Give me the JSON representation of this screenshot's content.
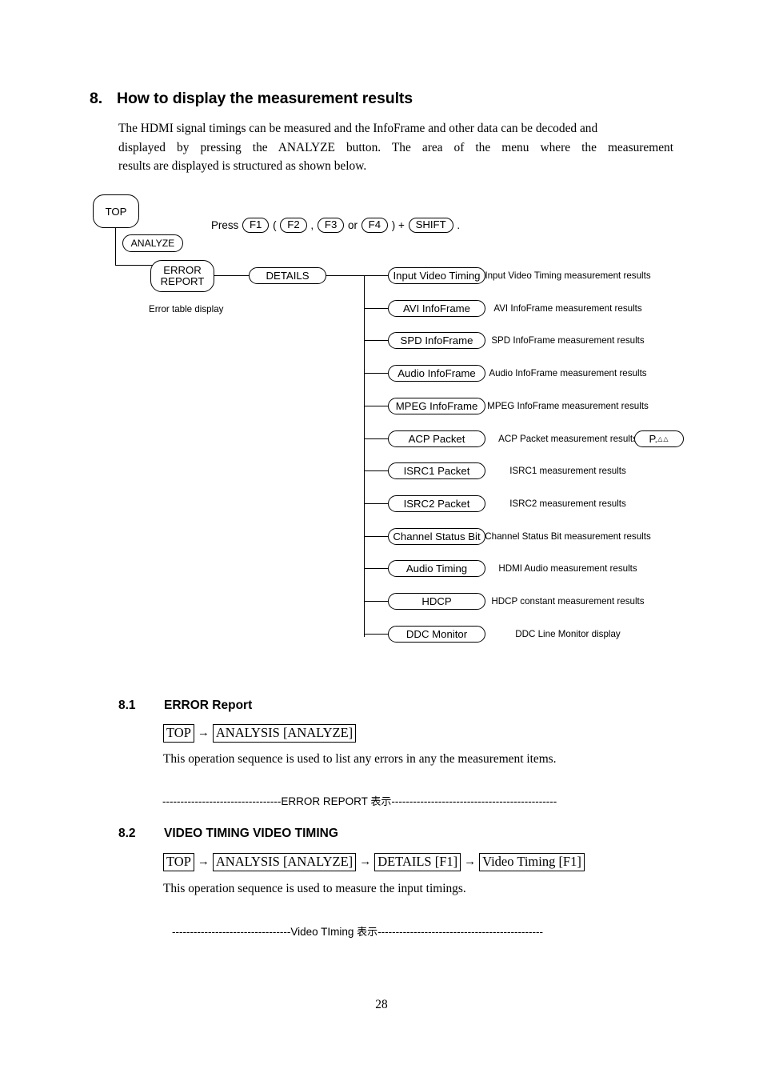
{
  "section": {
    "number": "8.",
    "title": "How to display the measurement results",
    "intro_lines": [
      "The HDMI signal timings can be measured and the InfoFrame and other data can be decoded and",
      "displayed by pressing the ANALYZE button.   The area of the menu where the measurement",
      "results are displayed is structured as shown below."
    ]
  },
  "diagram": {
    "top_node": "TOP",
    "analyze_node": "ANALYZE",
    "error_report_node": "ERROR\nREPORT",
    "error_report_line1": "ERROR",
    "error_report_line2": "REPORT",
    "error_note": "Error table display",
    "details_node": "DETAILS",
    "press_line": {
      "prefix": "Press",
      "key1": "F1",
      "open_paren": "(",
      "key2": "F2",
      "comma": ",",
      "key3": "F3",
      "or": "or",
      "key4": "F4",
      "close_paren": ")",
      "plus": "+",
      "key5": "SHIFT",
      "period": "."
    },
    "badge": {
      "label": "P.",
      "triangles": "△△"
    },
    "items": [
      {
        "label": "Input Video Timing",
        "desc": "Input Video Timing measurement results"
      },
      {
        "label": "AVI InfoFrame",
        "desc": "AVI InfoFrame measurement results"
      },
      {
        "label": "SPD InfoFrame",
        "desc": "SPD InfoFrame measurement results"
      },
      {
        "label": "Audio InfoFrame",
        "desc": "Audio InfoFrame measurement results"
      },
      {
        "label": "MPEG InfoFrame",
        "desc": "MPEG InfoFrame measurement results"
      },
      {
        "label": "ACP Packet",
        "desc": "ACP Packet measurement results"
      },
      {
        "label": "ISRC1 Packet",
        "desc": "ISRC1 measurement results"
      },
      {
        "label": "ISRC2 Packet",
        "desc": "ISRC2 measurement results"
      },
      {
        "label": "Channel Status Bit",
        "desc": "Channel Status Bit measurement results"
      },
      {
        "label": "Audio Timing",
        "desc": "HDMI Audio measurement results"
      },
      {
        "label": "HDCP",
        "desc": "HDCP constant measurement results"
      },
      {
        "label": "DDC Monitor",
        "desc": "DDC Line Monitor display"
      }
    ]
  },
  "sub1": {
    "number": "8.1",
    "title": "ERROR Report",
    "sequence": [
      "TOP",
      "ANALYSIS [ANALYZE]"
    ],
    "arrow": "→",
    "body": "This operation sequence is used to list any errors in any the measurement items.",
    "marker_prefix": "---------------------------------",
    "marker_label": "ERROR REPORT ",
    "marker_jp": "表示",
    "marker_suffix": "----------------------------------------------"
  },
  "sub2": {
    "number": "8.2",
    "title": "VIDEO TIMING VIDEO TIMING",
    "sequence": [
      "TOP",
      "ANALYSIS [ANALYZE]",
      "DETAILS [F1]",
      "Video Timing [F1]"
    ],
    "arrow": "→",
    "body": "This operation sequence is used to measure the input timings.",
    "marker_prefix": "---------------------------------",
    "marker_label": "Video TIming ",
    "marker_jp": "表示",
    "marker_suffix": "----------------------------------------------"
  },
  "footer": {
    "page_number": "28"
  }
}
